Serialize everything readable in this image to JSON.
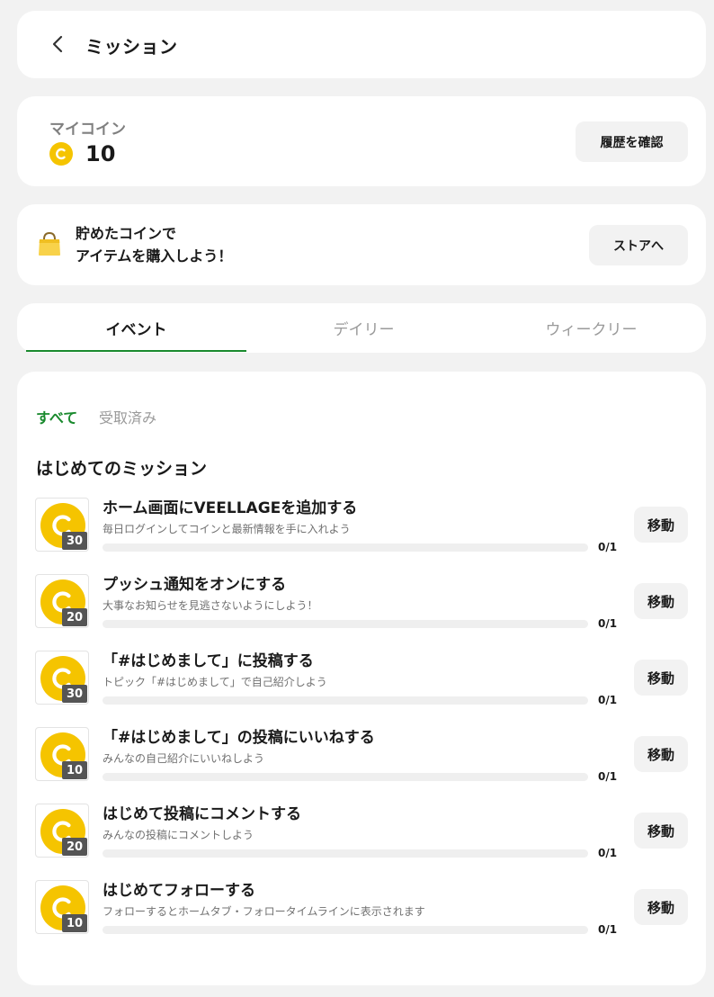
{
  "header": {
    "title": "ミッション"
  },
  "coins": {
    "label": "マイコイン",
    "value": "10",
    "history_label": "履歴を確認"
  },
  "store": {
    "line1": "貯めたコインで",
    "line2": "アイテムを購入しよう！",
    "button_label": "ストアへ"
  },
  "tabs": [
    {
      "label": "イベント",
      "active": true
    },
    {
      "label": "デイリー",
      "active": false
    },
    {
      "label": "ウィークリー",
      "active": false
    }
  ],
  "filters": [
    {
      "label": "すべて",
      "active": true
    },
    {
      "label": "受取済み",
      "active": false
    }
  ],
  "section_title": "はじめてのミッション",
  "move_label": "移動",
  "missions": [
    {
      "title": "ホーム画面にVEELLAGEを追加する",
      "desc": "毎日ログインしてコインと最新情報を手に入れよう",
      "reward": "30",
      "progress": "0/1",
      "fraction": 0
    },
    {
      "title": "プッシュ通知をオンにする",
      "desc": "大事なお知らせを見逃さないようにしよう！",
      "reward": "20",
      "progress": "0/1",
      "fraction": 0
    },
    {
      "title": "「#はじめまして」に投稿する",
      "desc": "トピック「#はじめまして」で自己紹介しよう",
      "reward": "30",
      "progress": "0/1",
      "fraction": 0
    },
    {
      "title": "「#はじめまして」の投稿にいいねする",
      "desc": "みんなの自己紹介にいいねしよう",
      "reward": "10",
      "progress": "0/1",
      "fraction": 0
    },
    {
      "title": "はじめて投稿にコメントする",
      "desc": "みんなの投稿にコメントしよう",
      "reward": "20",
      "progress": "0/1",
      "fraction": 0
    },
    {
      "title": "はじめてフォローする",
      "desc": "フォローするとホームタブ・フォロータイムラインに表示されます",
      "reward": "10",
      "progress": "0/1",
      "fraction": 0
    }
  ],
  "colors": {
    "accent_green": "#1a8a2e",
    "coin_yellow": "#f5c400",
    "badge_gray": "#555555"
  },
  "icons": {
    "back": "chevron-left-icon",
    "coin": "coin-icon",
    "store": "shopping-bag-icon"
  }
}
